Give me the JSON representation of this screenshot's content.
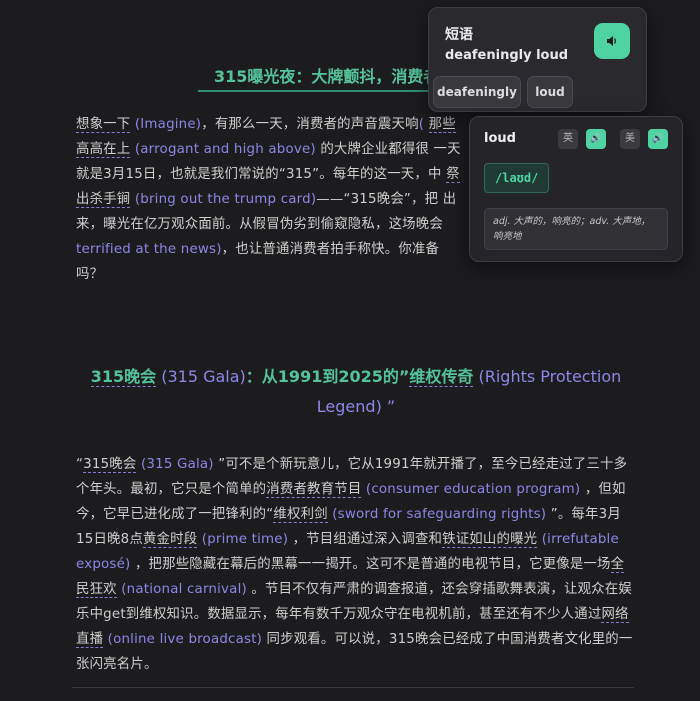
{
  "section_title": "315曝光夜：大牌颤抖，消费者",
  "para1": {
    "t1": "想象一下",
    "e1": "(Imagine)",
    "s1": "，有那么一天，消费者的声音震天响",
    "s1b": "(",
    "t2": "那些高高在上",
    "e2": "(arrogant and high above)",
    "s2": "的大牌企业都得很",
    "s3": "一天就是3月15日，也就是我们常说的“315”。每年的这一天，中",
    "t3": "祭出杀手锏",
    "e3": "(bring out the trump card)",
    "s4": "——“315晚会”，把",
    "s5": "出来，曝光在亿万观众面前。从假冒伪劣到偷窥隐私，这场晚会",
    "e4": "terrified at the news)",
    "s6": "，也让普通消费者拍手称快。你准备",
    "s7": "吗？"
  },
  "heading2": {
    "cn1": "315晚会",
    "en1": "(315 Gala)",
    "cn2": "：从1991到2025的”",
    "cn3": "维权传奇",
    "en2": "(Rights Protection",
    "en3": "Legend)",
    "end": " ”"
  },
  "para2": {
    "q1": "“",
    "t1": "315晚会",
    "e1": "(315 Gala)",
    "s1": "”可不是个新玩意儿，它从1991年就开播了，至今已经走过了三十多个年头。最初，它只是个简单的",
    "t2": "消费者教育节目",
    "e2": "(consumer education program)",
    "s2": "，但如今，它早已进化成了一把锋利的“",
    "t3": "维权利剑",
    "e3": "(sword for safeguarding rights)",
    "s3": "”。每年3月15日晚8点",
    "t4": "黄金时段",
    "e4": "(prime time)",
    "s4": "，节目组通过深入调查和",
    "t5": "铁证如山的曝光",
    "e5": "(irrefutable exposé)",
    "s5": "，把那些隐藏在幕后的黑幕一一揭开。这可不是普通的电视节目，它更像是一场",
    "t6": "全民狂欢",
    "e6": "(national carnival)",
    "s6": "。节目不仅有严肃的调查报道，还会穿插歌舞表演，让观众在娱乐中get到维权知识。数据显示，每年有数千万观众守在电视机前，甚至还有不少人通过",
    "t7": "网络直播",
    "e7": "(online live broadcast)",
    "s7": "同步观看。可以说，315晚会已经成了中国消费者文化里的一张闪亮名片。"
  },
  "phrase_card": {
    "label": "短语",
    "phrase": "deafeningly loud",
    "speak_icon": "speaker-icon",
    "chips": [
      "deafeningly",
      "loud"
    ]
  },
  "word_card": {
    "word": "loud",
    "uk_label": "英",
    "us_label": "美",
    "phonetic": "/laʊd/",
    "definition": "adj. 大声的，响亮的；adv. 大声地，响亮地"
  },
  "colors": {
    "accent_green": "#4fd3a3",
    "term_purple": "#8f86e6",
    "background": "#1c1c1f"
  }
}
